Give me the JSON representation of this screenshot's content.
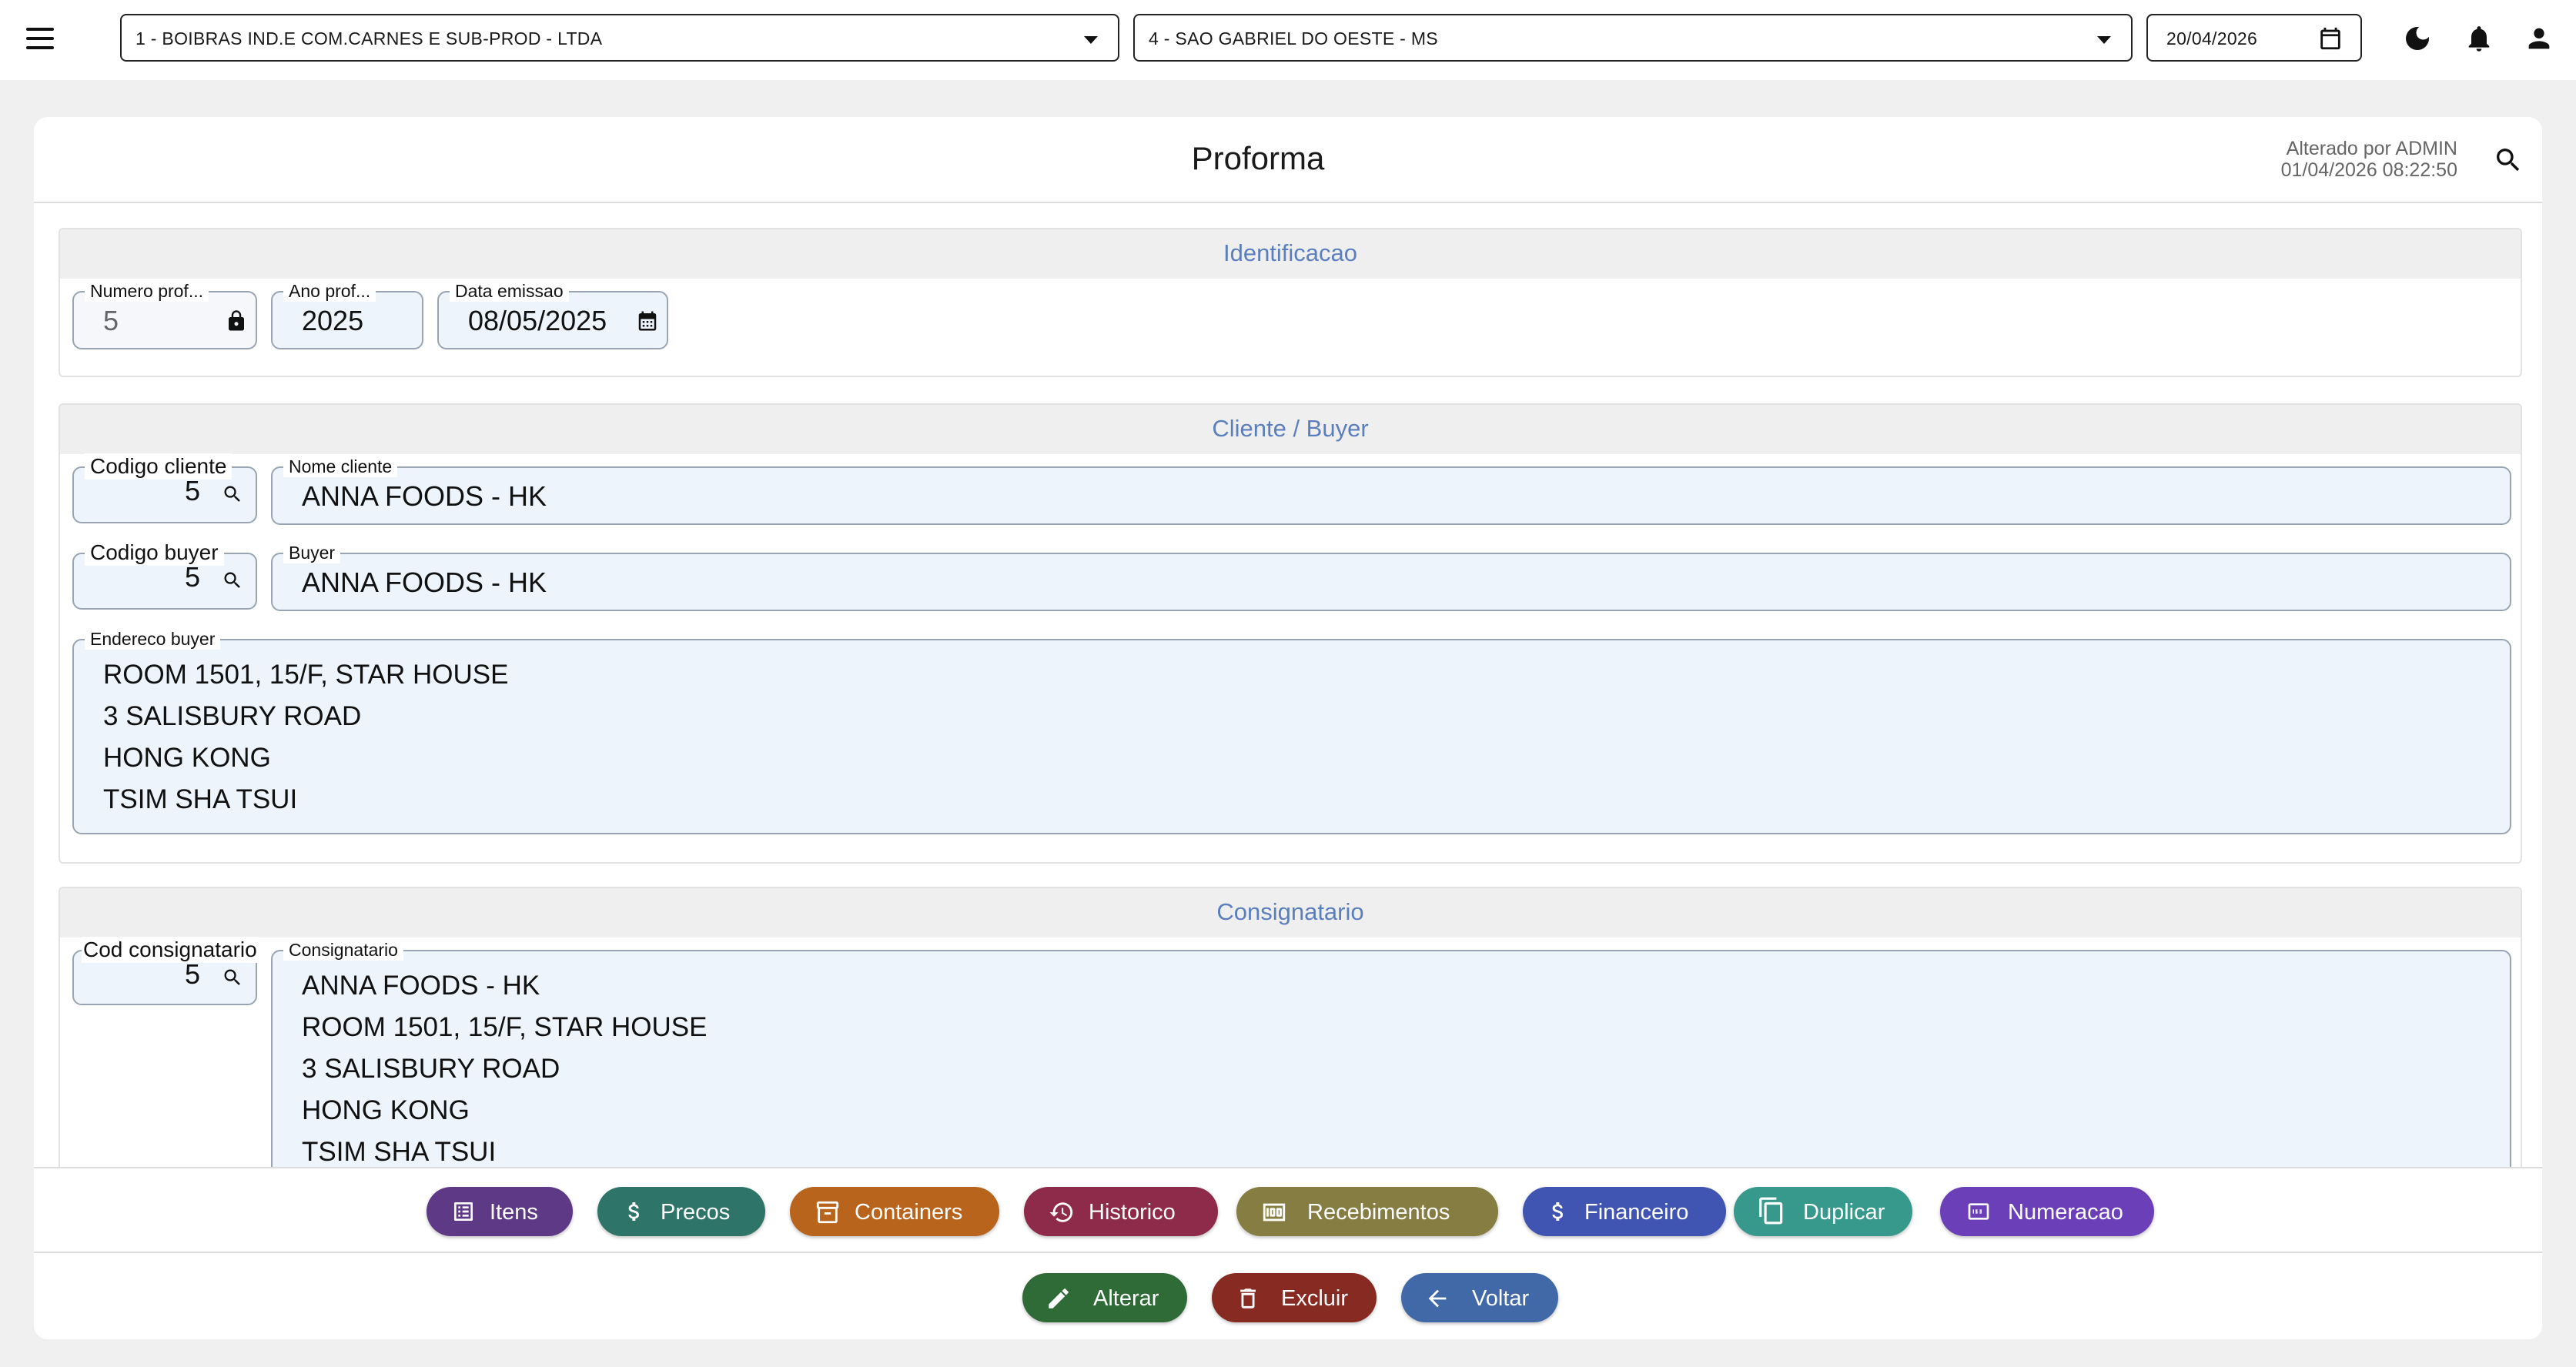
{
  "topbar": {
    "company": "1 - BOIBRAS IND.E COM.CARNES E SUB-PROD - LTDA",
    "branch": "4 - SAO GABRIEL DO OESTE - MS",
    "date": "20/04/2026",
    "icons": [
      "menu-icon",
      "calendar-icon",
      "moon-icon",
      "bell-icon",
      "person-icon"
    ]
  },
  "header": {
    "title": "Proforma",
    "changed_by": "Alterado por ADMIN",
    "changed_at": "01/04/2026 08:22:50"
  },
  "identificacao": {
    "title": "Identificacao",
    "numero_label": "Numero prof...",
    "numero_value": "5",
    "ano_label": "Ano prof...",
    "ano_value": "2025",
    "data_label": "Data emissao",
    "data_value": "08/05/2025"
  },
  "cliente": {
    "title": "Cliente / Buyer",
    "codigo_cliente_label": "Codigo cliente",
    "codigo_cliente_value": "5",
    "nome_cliente_label": "Nome cliente",
    "nome_cliente_value": "ANNA FOODS - HK",
    "codigo_buyer_label": "Codigo buyer",
    "codigo_buyer_value": "5",
    "buyer_label": "Buyer",
    "buyer_value": "ANNA FOODS - HK",
    "endereco_label": "Endereco buyer",
    "endereco_lines": [
      "ROOM 1501, 15/F, STAR HOUSE",
      "3 SALISBURY ROAD",
      "HONG KONG",
      "TSIM SHA TSUI"
    ]
  },
  "consignatario": {
    "title": "Consignatario",
    "cod_label": "Cod consignatario",
    "cod_value": "5",
    "nome_label": "Consignatario",
    "lines": [
      "ANNA FOODS - HK",
      "ROOM 1501, 15/F, STAR HOUSE",
      "3 SALISBURY ROAD",
      "HONG KONG",
      "TSIM SHA TSUI"
    ]
  },
  "actions": [
    {
      "label": "Itens",
      "icon": "list-icon",
      "color": "#5e3a86"
    },
    {
      "label": "Precos",
      "icon": "dollar-icon",
      "color": "#2e7468"
    },
    {
      "label": "Containers",
      "icon": "archive-icon",
      "color": "#b8641d"
    },
    {
      "label": "Historico",
      "icon": "history-icon",
      "color": "#8e2a4a"
    },
    {
      "label": "Recebimentos",
      "icon": "money-icon",
      "color": "#857d42"
    },
    {
      "label": "Financeiro",
      "icon": "dollar-icon",
      "color": "#4054b2"
    },
    {
      "label": "Duplicar",
      "icon": "copy-icon",
      "color": "#37998c"
    },
    {
      "label": "Numeracao",
      "icon": "numbers-icon",
      "color": "#6b3fb8"
    }
  ],
  "footer_actions": [
    {
      "label": "Alterar",
      "icon": "edit-icon",
      "color": "#2f6b36"
    },
    {
      "label": "Excluir",
      "icon": "trash-icon",
      "color": "#862a22"
    },
    {
      "label": "Voltar",
      "icon": "arrow-left-icon",
      "color": "#4169a8"
    }
  ]
}
